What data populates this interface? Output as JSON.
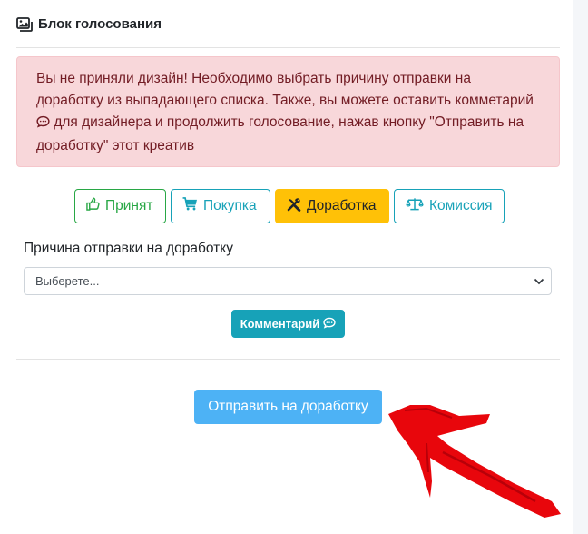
{
  "header": {
    "title": "Блок голосования",
    "icon": "images-icon"
  },
  "alert": {
    "text_before": "Вы не приняли дизайн! Необходимо выбрать причину отправки на доработку из выпадающего списка. Также, вы можете оставить комметарий",
    "text_after": "для дизайнера и продолжить голосование, нажав кнопку \"Отправить на доработку\" этот креатив",
    "icon": "comment-icon"
  },
  "vote_buttons": [
    {
      "label": "Принят",
      "icon": "thumbs-up-icon"
    },
    {
      "label": "Покупка",
      "icon": "cart-icon"
    },
    {
      "label": "Доработка",
      "icon": "tools-icon"
    },
    {
      "label": "Комиссия",
      "icon": "balance-scale-icon"
    }
  ],
  "reason": {
    "label": "Причина отправки на доработку",
    "selected": "Выберете..."
  },
  "comment_button": {
    "label": "Комментарий",
    "icon": "comment-icon"
  },
  "send_button": {
    "label": "Отправить на доработку"
  },
  "colors": {
    "success": "#28a745",
    "info": "#17a2b8",
    "warning": "#ffc107",
    "danger_bg": "#f8d7da",
    "primary_light": "#4db2f5",
    "annotation_arrow": "#e8060c"
  }
}
